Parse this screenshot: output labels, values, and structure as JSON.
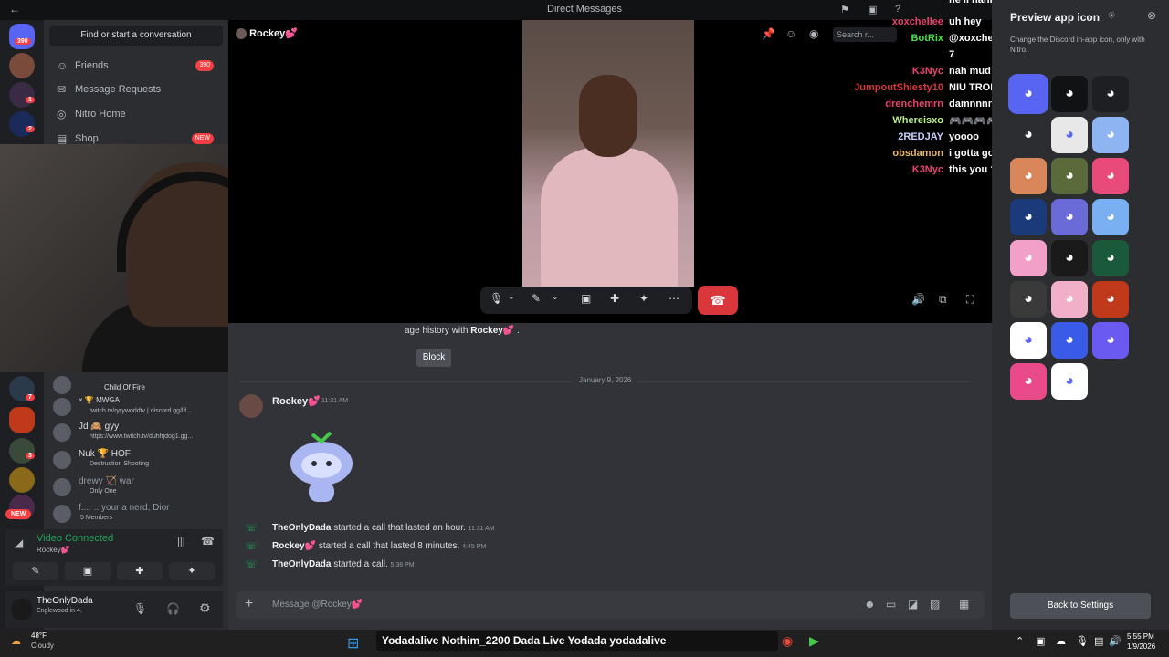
{
  "titlebar": {
    "title": "Direct Messages",
    "back": "←"
  },
  "servers": {
    "badge_top": "390",
    "badge2": "1",
    "badge3": "2",
    "badge4": "7",
    "badge5": "3",
    "new": "NEW"
  },
  "dm_sidebar": {
    "search_placeholder": "Find or start a conversation",
    "nav": [
      {
        "label": "Friends",
        "badge": "390",
        "icon": "friends-icon"
      },
      {
        "label": "Message Requests",
        "icon": "mail-icon"
      },
      {
        "label": "Nitro Home",
        "icon": "nitro-icon"
      },
      {
        "label": "Shop",
        "badge": "NEW",
        "icon": "shop-icon"
      }
    ],
    "dms": [
      {
        "name": "",
        "sub": "Child Of Fire"
      },
      {
        "name": "× 🏆 MWGA",
        "sub": "twitch.tv/ryryworldtv | discord.gg/lif..."
      },
      {
        "name": "Jd 🙈 gyy",
        "sub": "https://www.twitch.tv/duhhjdog1.gg..."
      },
      {
        "name": "Nuk 🏆 HOF",
        "sub": "Destruction Shooting"
      },
      {
        "name": "drewy 🏹 war",
        "sub": "Only One"
      },
      {
        "name": "f..., .. your a nerd, Dior",
        "sub": "5 Members"
      }
    ],
    "voice": {
      "status": "Video Connected",
      "channel": "Rockey💕"
    },
    "user": {
      "name": "TheOnlyDada",
      "status": "Englewood in 4."
    }
  },
  "header": {
    "recipient": "Rockey💕",
    "search_placeholder": "Search r..."
  },
  "chat_overlay": [
    {
      "user": "",
      "msg": "he ll nannn",
      "color": "#e8e8e8"
    },
    {
      "user": "xoxchellee",
      "msg": "uh hey",
      "color": "#e8436f"
    },
    {
      "user": "BotRix",
      "msg": "@xoxchellee you leveled up to Level",
      "color": "#4be04b"
    },
    {
      "user": "",
      "msg": "7",
      "color": "#ffffff"
    },
    {
      "user": "K3Nyc",
      "msg": "nah mud",
      "color": "#e8436f"
    },
    {
      "user": "JumpoutShiesty10",
      "msg": "NIU TROLLING",
      "color": "#d63a3a"
    },
    {
      "user": "drenchemrn",
      "msg": "damnnnn who this",
      "color": "#e8436f"
    },
    {
      "user": "Whereisxo",
      "msg": "🎮🎮🎮🎮🎮🎮",
      "color": "#b6f08a"
    },
    {
      "user": "2REDJAY",
      "msg": "yoooo",
      "color": "#c8d0ff"
    },
    {
      "user": "obsdamon",
      "msg": "i gotta go",
      "color": "#e8b96a"
    },
    {
      "user": "K3Nyc",
      "msg": "this you ?",
      "color": "#e8436f"
    }
  ],
  "history": {
    "text_prefix": "age history with",
    "name": "Rockey💕",
    "suffix": ".",
    "block": "Block",
    "date": "January 9, 2026"
  },
  "messages": [
    {
      "author": "Rockey💕",
      "time": "11:31 AM"
    },
    {
      "caller": "TheOnlyDada",
      "text": "started a call that lasted an hour.",
      "time": "11:31 AM"
    },
    {
      "caller": "Rockey💕",
      "text": "started a call that lasted 8 minutes.",
      "time": "4:45 PM"
    },
    {
      "caller": "TheOnlyDada",
      "text": "started a call.",
      "time": "5:38 PM"
    }
  ],
  "composer": {
    "placeholder": "Message @Rockey💕"
  },
  "settings_panel": {
    "title": "Preview app icon",
    "desc": "Change the Discord in-app icon, only with Nitro.",
    "back": "Back to Settings"
  },
  "taskbar": {
    "temp": "48°F",
    "weather": "Cloudy",
    "overlay": "Yodadalive  Nothim_2200  Dada Live  Yodada  yodadalive",
    "time": "5:55 PM",
    "date": "1/9/2026"
  }
}
